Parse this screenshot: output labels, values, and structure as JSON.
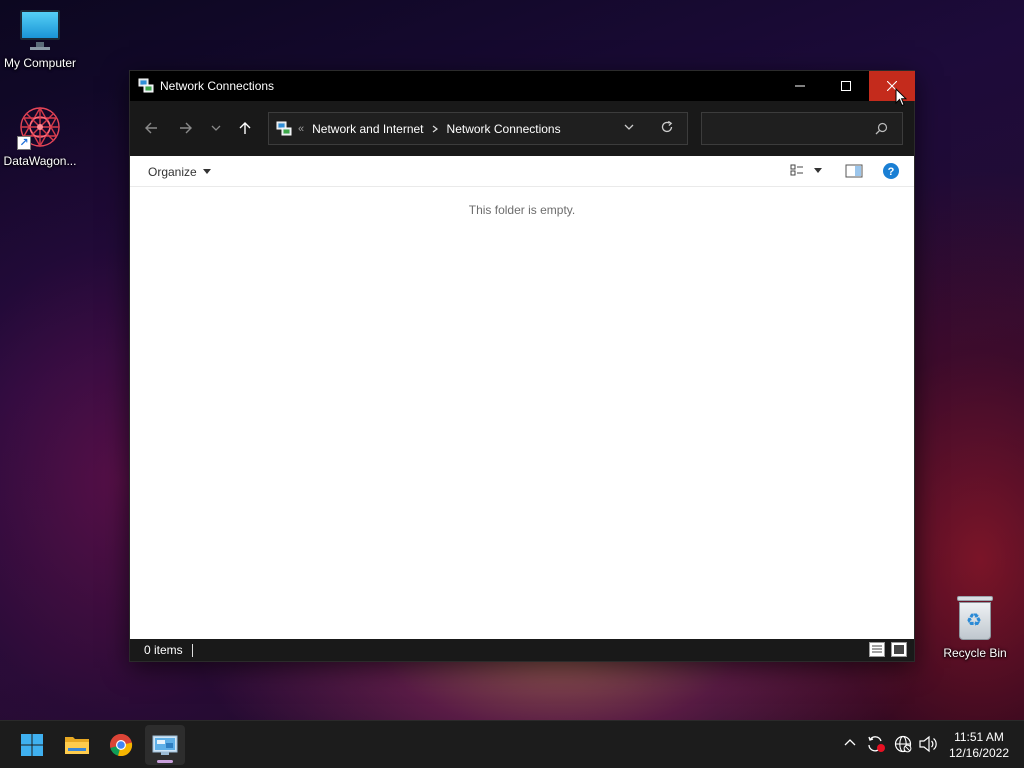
{
  "desktop": {
    "icons": [
      {
        "label": "My Computer"
      },
      {
        "label": "DataWagon..."
      },
      {
        "label": "Recycle Bin"
      }
    ]
  },
  "window": {
    "title": "Network Connections",
    "address": {
      "overflow_glyph": "«",
      "crumbs": [
        "Network and Internet",
        "Network Connections"
      ]
    },
    "search": {
      "placeholder": "",
      "value": ""
    },
    "command_bar": {
      "organize_label": "Organize"
    },
    "content": {
      "empty_message": "This folder is empty."
    },
    "status": {
      "item_count": "0 items"
    }
  },
  "taskbar": {
    "pinned": [
      "windows-start",
      "file-explorer",
      "chrome",
      "network-connections"
    ],
    "clock": {
      "time": "11:51 AM",
      "date": "12/16/2022"
    }
  },
  "colors": {
    "close_button": "#c42b1c",
    "help_blue": "#1a7fd4",
    "titlebar": "#000000",
    "navbar": "#191919",
    "taskbar": "#1c1c1c"
  }
}
